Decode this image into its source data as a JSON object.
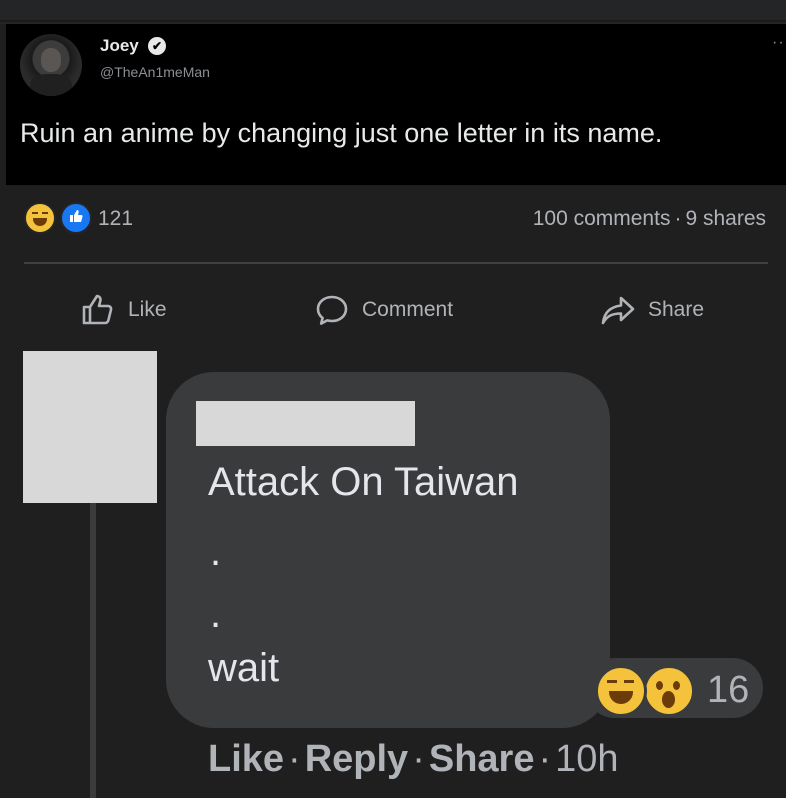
{
  "tweet": {
    "name": "Joey",
    "verified_mark": "✔",
    "handle": "@TheAn1meMan",
    "more": "··",
    "text": "Ruin an anime by changing just one letter in its name."
  },
  "post_stats": {
    "reaction_icons": [
      "haha-icon",
      "like-icon"
    ],
    "reaction_count": "121",
    "comments": "100 comments",
    "separator": "·",
    "shares": "9 shares"
  },
  "actions": {
    "like": "Like",
    "comment": "Comment",
    "share": "Share"
  },
  "comment": {
    "line1": "Attack On Taiwan",
    "dot1": ".",
    "dot2": ".",
    "line4": "wait",
    "reaction_icons": [
      "haha-icon",
      "wow-icon"
    ],
    "reaction_count": "16",
    "like": "Like",
    "reply": "Reply",
    "share": "Share",
    "separator": "·",
    "time": "10h"
  },
  "colors": {
    "background": "#1f1f20",
    "tweet_background": "#000000",
    "bubble": "#3a3b3c",
    "like_blue": "#1877f2",
    "reaction_yellow": "#f5c33b",
    "redaction": "#d8d8d8"
  }
}
